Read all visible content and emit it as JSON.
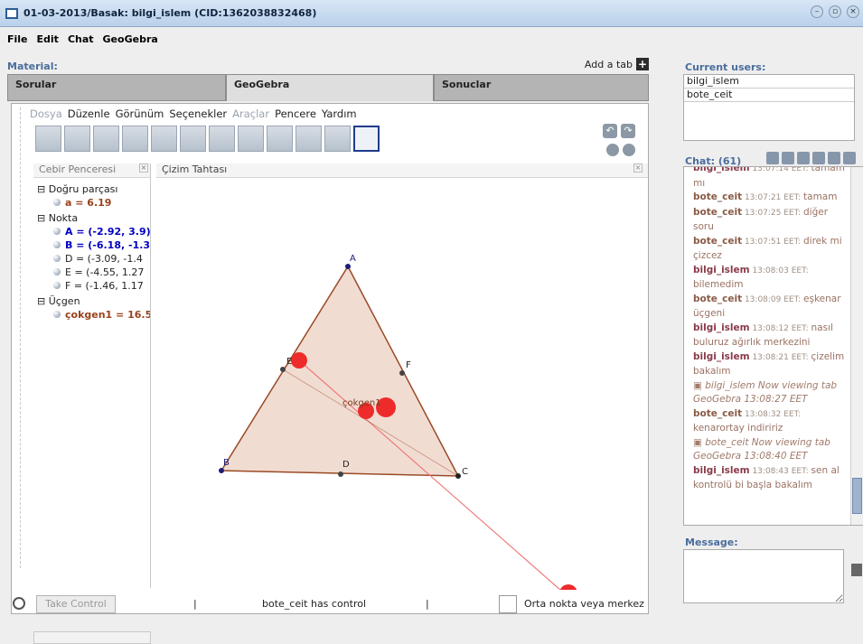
{
  "window": {
    "title": "01-03-2013/Basak: bilgi_islem (CID:1362038832468)"
  },
  "menu": [
    "File",
    "Edit",
    "Chat",
    "GeoGebra"
  ],
  "material": {
    "label": "Material:",
    "add_tab": "Add a tab",
    "tabs": [
      "Sorular",
      "GeoGebra",
      "Sonuclar"
    ],
    "active_tab": "GeoGebra"
  },
  "geogebra": {
    "menu": [
      "Dosya",
      "Düzenle",
      "Görünüm",
      "Seçenekler",
      "Araçlar",
      "Pencere",
      "Yardım"
    ],
    "algebra_title": "Cebir Penceresi",
    "drawing_title": "Çizim Tahtası",
    "algebra": {
      "g1": "Doğru parçası",
      "g1_a": "a = 6.19",
      "g2": "Nokta",
      "A": "A = (-2.92, 3.9)",
      "B": "B = (-6.18, -1.3",
      "D": "D = (-3.09, -1.4",
      "E": "E = (-4.55, 1.27",
      "F": "F = (-1.46, 1.17",
      "g3": "Üçgen",
      "poly": "çokgen1 = 16.5"
    },
    "canvas_labels": {
      "A": "A",
      "B": "B",
      "C": "C",
      "D": "D",
      "E": "E",
      "F": "F",
      "poly": "çokgen1"
    },
    "colors": {
      "polygon_fill": "#f1dcd2",
      "polygon_stroke": "#9a4a25",
      "red": "#ee2b2b",
      "line": "#f07a7a"
    }
  },
  "status": {
    "take_control": "Take Control",
    "control_text": "bote_ceit has control",
    "sep": "|",
    "mode": "Orta nokta veya merkez"
  },
  "users": {
    "label": "Current users:",
    "list": [
      "bilgi_islem",
      "bote_ceit"
    ]
  },
  "chat": {
    "label": "Chat: (61)",
    "messages": [
      {
        "user": "bilgi_islem",
        "time": "13:07:14 EET:",
        "text": "tamam mı"
      },
      {
        "user": "bote_ceit",
        "time": "13:07:21 EET:",
        "text": "tamam"
      },
      {
        "user": "bote_ceit",
        "time": "13:07:25 EET:",
        "text": "diğer soru"
      },
      {
        "user": "bote_ceit",
        "time": "13:07:51 EET:",
        "text": "direk mi çizcez"
      },
      {
        "user": "bilgi_islem",
        "time": "13:08:03 EET:",
        "text": "bilemedim"
      },
      {
        "user": "bote_ceit",
        "time": "13:08:09 EET:",
        "text": "eşkenar üçgeni"
      },
      {
        "user": "bilgi_islem",
        "time": "13:08:12 EET:",
        "text": "nasıl buluruz ağırlık merkezini"
      },
      {
        "user": "bilgi_islem",
        "time": "13:08:21 EET:",
        "text": "çizelim bakalım"
      },
      {
        "view": "bilgi_islem Now viewing tab GeoGebra 13:08:27 EET"
      },
      {
        "user": "bote_ceit",
        "time": "13:08:32 EET:",
        "text": "kenarortay indiririz"
      },
      {
        "view": "bote_ceit Now viewing tab GeoGebra 13:08:40 EET"
      },
      {
        "user": "bilgi_islem",
        "time": "13:08:43 EET:",
        "text": "sen al kontrolü bi başla bakalım"
      }
    ]
  },
  "message": {
    "label": "Message:"
  }
}
